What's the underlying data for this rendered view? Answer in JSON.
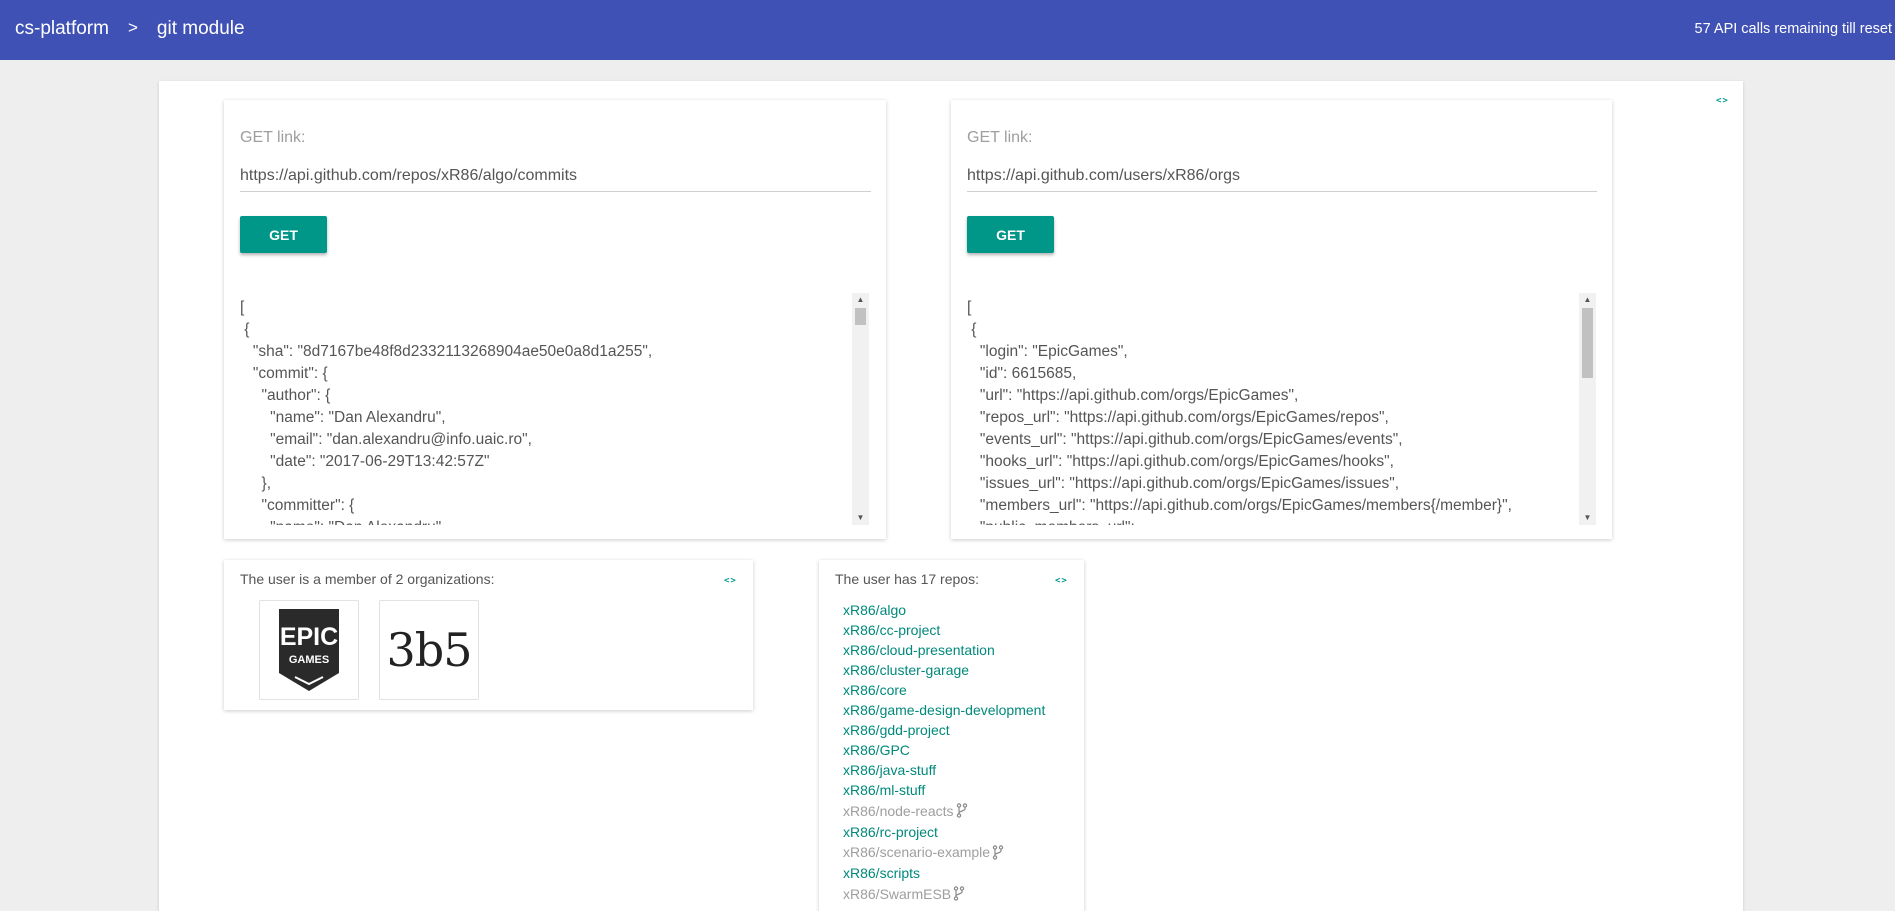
{
  "header": {
    "breadcrumb": [
      "cs-platform",
      "git module"
    ],
    "separator": ">",
    "api_remaining": "57 API calls remaining till reset",
    "color": "#3f51b5"
  },
  "code_toggle_label": "<>",
  "accent_color": "#009688",
  "left_panel": {
    "label": "GET link:",
    "url": "https://api.github.com/repos/xR86/algo/commits",
    "button": "GET",
    "json": "[\n {\n   \"sha\": \"8d7167be48f8d2332113268904ae50e0a8d1a255\",\n   \"commit\": {\n     \"author\": {\n       \"name\": \"Dan Alexandru\",\n       \"email\": \"dan.alexandru@info.uaic.ro\",\n       \"date\": \"2017-06-29T13:42:57Z\"\n     },\n     \"committer\": {\n       \"name\": \"Dan Alexandru\","
  },
  "right_panel": {
    "label": "GET link:",
    "url": "https://api.github.com/users/xR86/orgs",
    "button": "GET",
    "json": "[\n {\n   \"login\": \"EpicGames\",\n   \"id\": 6615685,\n   \"url\": \"https://api.github.com/orgs/EpicGames\",\n   \"repos_url\": \"https://api.github.com/orgs/EpicGames/repos\",\n   \"events_url\": \"https://api.github.com/orgs/EpicGames/events\",\n   \"hooks_url\": \"https://api.github.com/orgs/EpicGames/hooks\",\n   \"issues_url\": \"https://api.github.com/orgs/EpicGames/issues\",\n   \"members_url\": \"https://api.github.com/orgs/EpicGames/members{/member}\",\n   \"public_members_url\":"
  },
  "orgs": {
    "title": "The user is a member of 2 organizations:",
    "items": [
      {
        "logo_top": "EPIC",
        "logo_bottom": "GAMES"
      },
      {
        "logo_text": "3b5"
      }
    ]
  },
  "repos": {
    "title": "The user has 17 repos:",
    "items": [
      {
        "name": "xR86/algo",
        "fork": false
      },
      {
        "name": "xR86/cc-project",
        "fork": false
      },
      {
        "name": "xR86/cloud-presentation",
        "fork": false
      },
      {
        "name": "xR86/cluster-garage",
        "fork": false
      },
      {
        "name": "xR86/core",
        "fork": false
      },
      {
        "name": "xR86/game-design-development",
        "fork": false
      },
      {
        "name": "xR86/gdd-project",
        "fork": false
      },
      {
        "name": "xR86/GPC",
        "fork": false
      },
      {
        "name": "xR86/java-stuff",
        "fork": false
      },
      {
        "name": "xR86/ml-stuff",
        "fork": false
      },
      {
        "name": "xR86/node-reacts",
        "fork": true
      },
      {
        "name": "xR86/rc-project",
        "fork": false
      },
      {
        "name": "xR86/scenario-example",
        "fork": true
      },
      {
        "name": "xR86/scripts",
        "fork": false
      },
      {
        "name": "xR86/SwarmESB",
        "fork": true
      }
    ]
  }
}
